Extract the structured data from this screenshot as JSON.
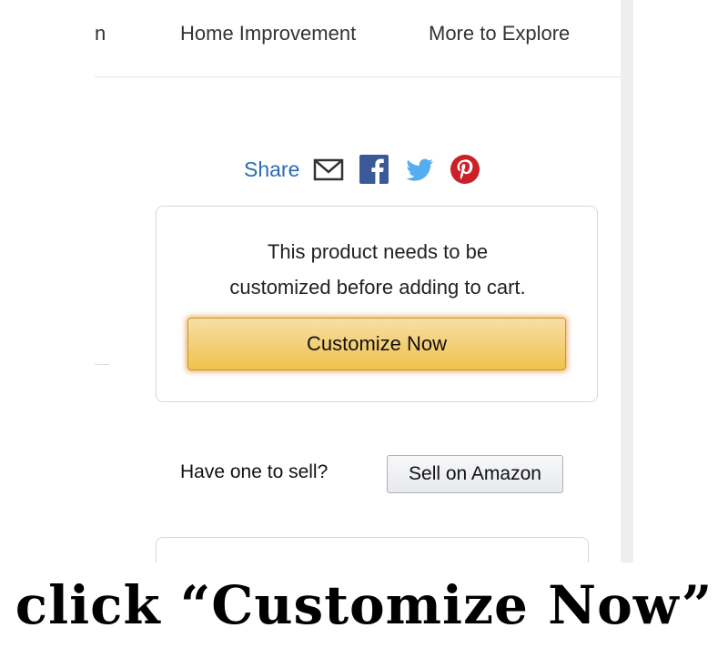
{
  "nav": {
    "items": [
      {
        "label": "n"
      },
      {
        "label": "Home Improvement"
      },
      {
        "label": "More to Explore"
      }
    ]
  },
  "share": {
    "label": "Share",
    "icons": [
      "mail-icon",
      "facebook-icon",
      "twitter-icon",
      "pinterest-icon"
    ]
  },
  "buy_box": {
    "message_line1": "This product needs to be",
    "message_line2": "customized before adding to cart.",
    "customize_button": "Customize Now"
  },
  "sell": {
    "question": "Have one to sell?",
    "button": "Sell on Amazon"
  },
  "caption": "click “Customize Now”",
  "colors": {
    "share_link": "#2b6cb0",
    "facebook": "#3b5998",
    "twitter": "#55acee",
    "pinterest": "#cb2027",
    "customize_button": "#f0c14b"
  }
}
